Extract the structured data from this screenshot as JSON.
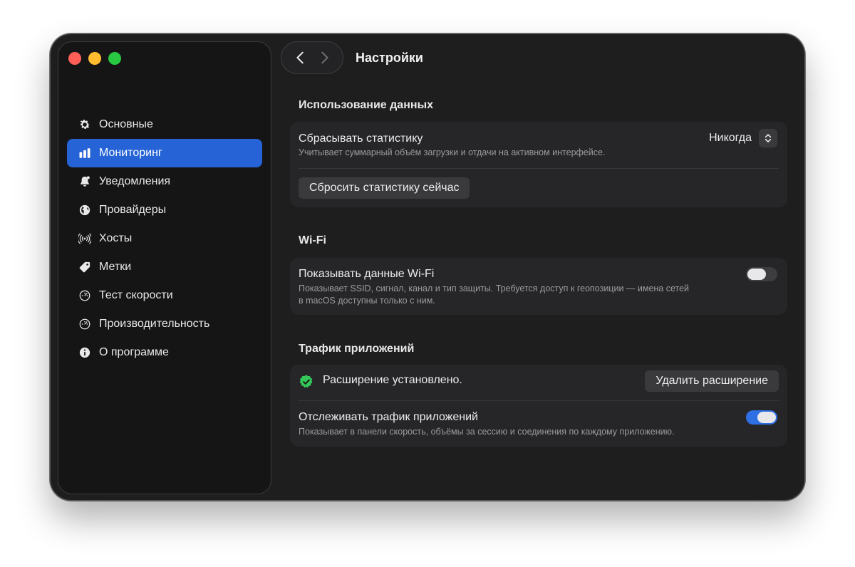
{
  "window": {
    "title": "Настройки"
  },
  "sidebar": {
    "items": [
      {
        "label": "Основные",
        "icon": "gear-icon",
        "active": false
      },
      {
        "label": "Мониторинг",
        "icon": "bar-chart-icon",
        "active": true
      },
      {
        "label": "Уведомления",
        "icon": "bell-icon",
        "active": false
      },
      {
        "label": "Провайдеры",
        "icon": "globe-icon",
        "active": false
      },
      {
        "label": "Хосты",
        "icon": "broadcast-icon",
        "active": false
      },
      {
        "label": "Метки",
        "icon": "tag-icon",
        "active": false
      },
      {
        "label": "Тест скорости",
        "icon": "gauge-icon",
        "active": false
      },
      {
        "label": "Производительность",
        "icon": "gauge-icon",
        "active": false
      },
      {
        "label": "О программе",
        "icon": "info-icon",
        "active": false
      }
    ]
  },
  "sections": {
    "data_usage": {
      "title": "Использование данных",
      "reset_stats": {
        "title": "Сбрасывать статистику",
        "subtitle": "Учитывает суммарный объём загрузки и отдачи на активном интерфейсе.",
        "selected": "Никогда"
      },
      "reset_now_label": "Сбросить статистику сейчас"
    },
    "wifi": {
      "title": "Wi-Fi",
      "show_wifi": {
        "title": "Показывать данные Wi-Fi",
        "subtitle_line1": "Показывает SSID, сигнал, канал и тип защиты. Требуется доступ к геопозиции — имена сетей",
        "subtitle_line2": "в macOS доступны только с ним.",
        "enabled": false
      }
    },
    "app_traffic": {
      "title": "Трафик приложений",
      "extension_status": "Расширение установлено.",
      "remove_extension_label": "Удалить расширение",
      "track": {
        "title": "Отслеживать трафик приложений",
        "subtitle": "Показывает в панели скорость, объёмы за сессию и соединения по каждому приложению.",
        "enabled": true
      }
    }
  },
  "colors": {
    "accent": "#2563d6",
    "toggle_on": "#2f6fe4",
    "success": "#34c759",
    "window_bg": "#1e1e1f",
    "sidebar_bg": "#151516",
    "card_bg": "#262628"
  }
}
